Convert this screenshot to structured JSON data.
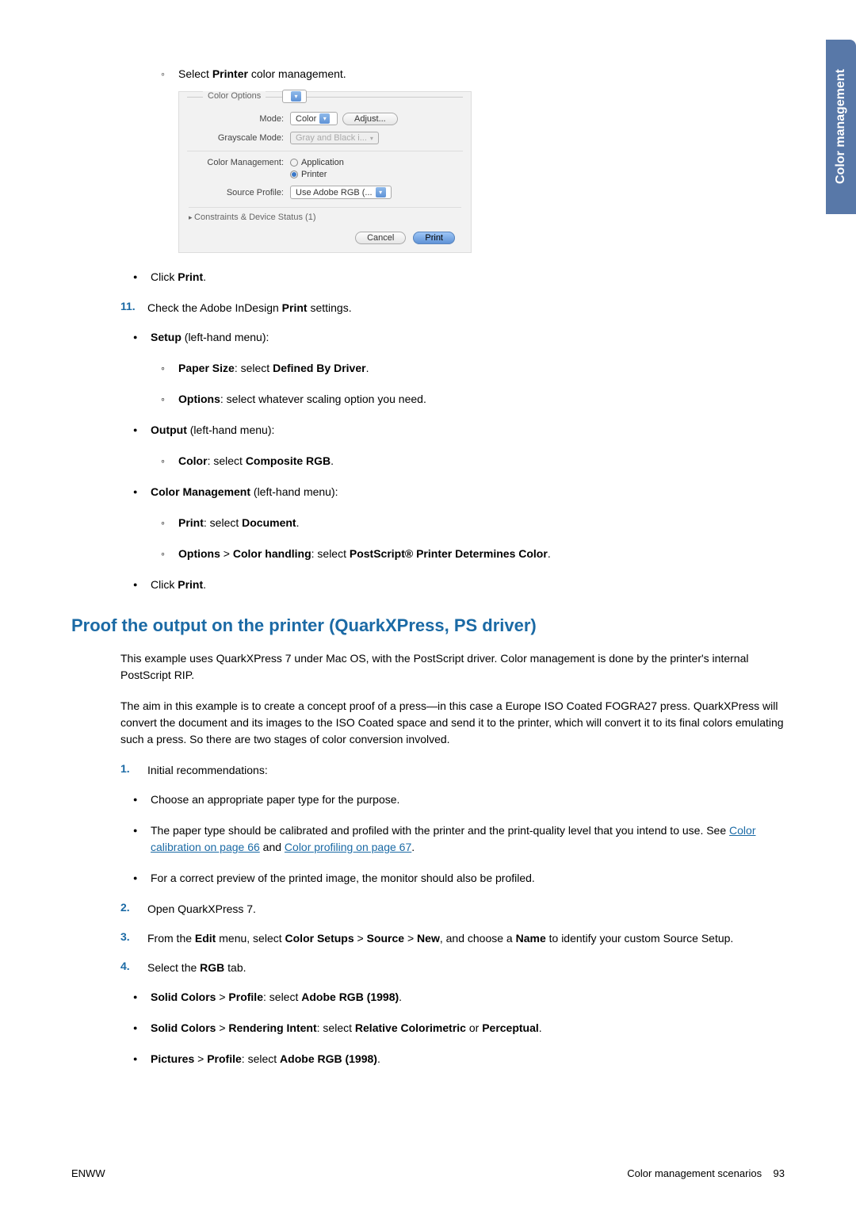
{
  "side_tab": "Color management",
  "top": {
    "sub_item": {
      "pre": "Select ",
      "bold": "Printer",
      "post": " color management."
    }
  },
  "dialog": {
    "fieldset_label": "Color Options",
    "rows": {
      "mode": {
        "label": "Mode:",
        "value": "Color",
        "adjust": "Adjust..."
      },
      "grayscale": {
        "label": "Grayscale Mode:",
        "value": "Gray and Black i..."
      },
      "cm": {
        "label": "Color Management:",
        "opt1": "Application",
        "opt2": "Printer"
      },
      "profile": {
        "label": "Source Profile:",
        "value": "Use Adobe RGB (..."
      }
    },
    "disclosure": "Constraints & Device Status (1)",
    "buttons": {
      "cancel": "Cancel",
      "print": "Print"
    }
  },
  "step10_click": {
    "pre": "Click ",
    "bold": "Print",
    "post": "."
  },
  "step11": {
    "num": "11.",
    "intro": {
      "pre": "Check the Adobe InDesign ",
      "bold": "Print",
      "post": " settings."
    },
    "setup": {
      "bold": "Setup",
      "post": " (left-hand menu):"
    },
    "setup_paper": {
      "b1": "Paper Size",
      "mid": ": select ",
      "b2": "Defined By Driver",
      "end": "."
    },
    "setup_options": {
      "b1": "Options",
      "post": ": select whatever scaling option you need."
    },
    "output": {
      "bold": "Output",
      "post": " (left-hand menu):"
    },
    "output_color": {
      "b1": "Color",
      "mid": ": select ",
      "b2": "Composite RGB",
      "end": "."
    },
    "cm": {
      "bold": "Color Management",
      "post": " (left-hand menu):"
    },
    "cm_print": {
      "b1": "Print",
      "mid": ": select ",
      "b2": "Document",
      "end": "."
    },
    "cm_options": {
      "b1": "Options",
      "mid1": " > ",
      "b2": "Color handling",
      "mid2": ": select ",
      "b3": "PostScript® Printer Determines Color",
      "end": "."
    },
    "click_print": {
      "pre": "Click ",
      "bold": "Print",
      "post": "."
    }
  },
  "section_heading": "Proof the output on the printer (QuarkXPress, PS driver)",
  "para1": "This example uses QuarkXPress 7 under Mac OS, with the PostScript driver. Color management is done by the printer's internal PostScript RIP.",
  "para2": "The aim in this example is to create a concept proof of a press—in this case a Europe ISO Coated FOGRA27 press. QuarkXPress will convert the document and its images to the ISO Coated space and send it to the printer, which will convert it to its final colors emulating such a press. So there are two stages of color conversion involved.",
  "steps": {
    "s1": {
      "num": "1.",
      "text": "Initial recommendations:",
      "b1": "Choose an appropriate paper type for the purpose.",
      "b2_pre": "The paper type should be calibrated and profiled with the printer and the print-quality level that you intend to use. See ",
      "b2_link1": "Color calibration on page 66",
      "b2_mid": " and ",
      "b2_link2": "Color profiling on page 67",
      "b2_end": ".",
      "b3": "For a correct preview of the printed image, the monitor should also be profiled."
    },
    "s2": {
      "num": "2.",
      "text": "Open QuarkXPress 7."
    },
    "s3": {
      "num": "3.",
      "pre": "From the ",
      "b1": "Edit",
      "m1": " menu, select ",
      "b2": "Color Setups",
      "m2": " > ",
      "b3": "Source",
      "m3": " > ",
      "b4": "New",
      "m4": ", and choose a ",
      "b5": "Name",
      "post": " to identify your custom Source Setup."
    },
    "s4": {
      "num": "4.",
      "pre": "Select the ",
      "b1": "RGB",
      "post": " tab.",
      "sc1": {
        "b1": "Solid Colors",
        "m1": " > ",
        "b2": "Profile",
        "m2": ": select ",
        "b3": "Adobe RGB (1998)",
        "end": "."
      },
      "sc2": {
        "b1": "Solid Colors",
        "m1": " > ",
        "b2": "Rendering Intent",
        "m2": ": select ",
        "b3": "Relative Colorimetric",
        "m3": " or ",
        "b4": "Perceptual",
        "end": "."
      },
      "pic": {
        "b1": "Pictures",
        "m1": " > ",
        "b2": "Profile",
        "m2": ": select ",
        "b3": "Adobe RGB (1998)",
        "end": "."
      }
    }
  },
  "footer": {
    "left": "ENWW",
    "right_label": "Color management scenarios",
    "page": "93"
  }
}
